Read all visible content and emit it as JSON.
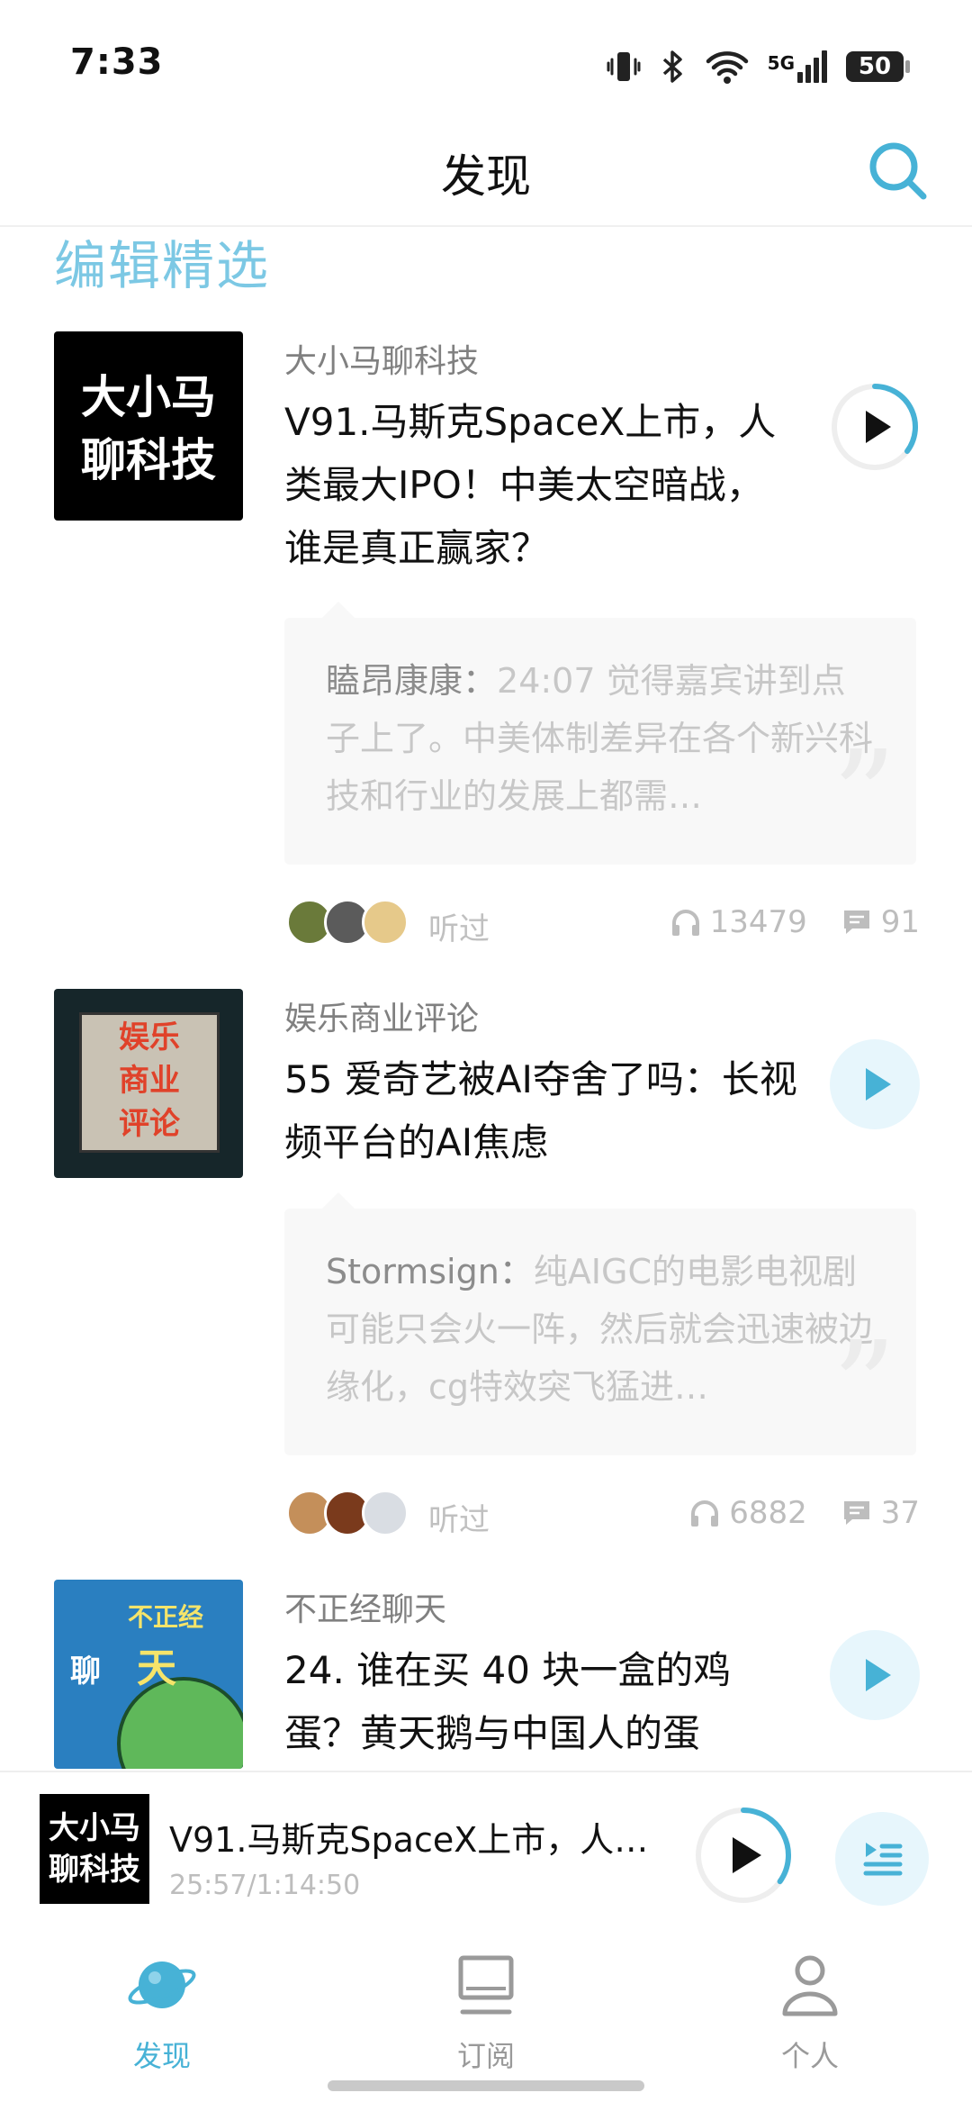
{
  "status_bar": {
    "time": "7:33",
    "network": "5G",
    "battery": "50"
  },
  "header": {
    "title": "发现"
  },
  "section": {
    "title": "编辑精选"
  },
  "cards": [
    {
      "podcast": "大小马聊科技",
      "cover_text": [
        "大小马",
        "聊科技"
      ],
      "title": "V91.马斯克SpaceX上市，人类最大IPO！中美太空暗战，谁是真正赢家？",
      "comment_user": "瞌昂康康：",
      "comment_text": "24:07 觉得嘉宾讲到点子上了。中美体制差异在各个新兴科技和行业的发展上都需…",
      "listened_label": "听过",
      "plays": "13479",
      "comments": "91"
    },
    {
      "podcast": "娱乐商业评论",
      "cover_text": [
        "娱乐",
        "商业",
        "评论"
      ],
      "title": "55 爱奇艺被AI夺舍了吗：长视频平台的AI焦虑",
      "comment_user": "Stormsign：",
      "comment_text": "纯AIGC的电影电视剧可能只会火一阵，然后就会迅速被边缘化，cg特效突飞猛进…",
      "listened_label": "听过",
      "plays": "6882",
      "comments": "37"
    },
    {
      "podcast": "不正经聊天",
      "cover_text": [
        "不正经",
        "聊",
        "天"
      ],
      "title": "24. 谁在买 40 块一盒的鸡蛋？黄天鹅与中国人的蛋"
    }
  ],
  "player": {
    "cover_text": [
      "大小马",
      "聊科技"
    ],
    "title": "V91.马斯克SpaceX上市，人…",
    "time": "25:57/1:14:50",
    "progress": 0.349
  },
  "nav": {
    "discover": "发现",
    "subscribe": "订阅",
    "profile": "个人"
  },
  "colors": {
    "accent": "#47b2d6",
    "section_title": "#7cc8e4",
    "play_bg": "#e7f6fc"
  }
}
